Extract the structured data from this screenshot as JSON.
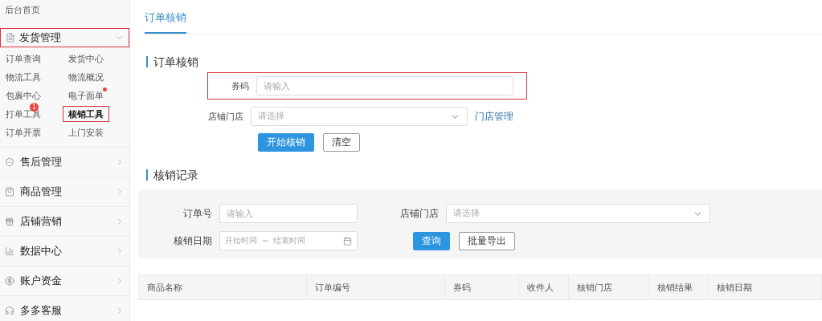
{
  "sidebar": {
    "home": "后台首页",
    "open_group": {
      "label": "发货管理",
      "kind": "doc",
      "expanded": true,
      "highlighted": true,
      "items": [
        {
          "label": "订单查询",
          "selected": false,
          "highlighted": false
        },
        {
          "label": "发货中心",
          "selected": false,
          "highlighted": false
        },
        {
          "label": "物流工具",
          "selected": false,
          "highlighted": false
        },
        {
          "label": "物流概况",
          "selected": false,
          "highlighted": false
        },
        {
          "label": "包裹中心",
          "selected": false,
          "highlighted": false
        },
        {
          "label": "电子面单",
          "selected": false,
          "highlighted": false,
          "dot": true
        },
        {
          "label": "打单工具",
          "selected": false,
          "highlighted": false,
          "badge": "1"
        },
        {
          "label": "核销工具",
          "selected": true,
          "highlighted": true
        },
        {
          "label": "订单开票",
          "selected": false,
          "highlighted": false
        },
        {
          "label": "上门安装",
          "selected": false,
          "highlighted": false
        }
      ]
    },
    "groups": [
      {
        "label": "售后管理",
        "kind": "shield",
        "expanded": false
      },
      {
        "label": "商品管理",
        "kind": "bag",
        "expanded": false
      },
      {
        "label": "店铺营销",
        "kind": "gift",
        "expanded": false
      },
      {
        "label": "数据中心",
        "kind": "chart",
        "expanded": false
      },
      {
        "label": "账户资金",
        "kind": "yen",
        "expanded": false
      },
      {
        "label": "多多客服",
        "kind": "headset",
        "expanded": false
      }
    ]
  },
  "tabs": [
    {
      "label": "订单核销",
      "selected": true
    }
  ],
  "verify": {
    "title": "订单核销",
    "fields": [
      {
        "kind": "input",
        "label": "券码",
        "placeholder": "请输入",
        "highlighted": true
      },
      {
        "kind": "select",
        "label": "店铺门店",
        "placeholder": "请选择",
        "link": "门店管理",
        "highlighted": false
      }
    ],
    "buttons": [
      {
        "label": "开始核销",
        "primary": true
      },
      {
        "label": "清空",
        "primary": false
      }
    ]
  },
  "records": {
    "title": "核销记录",
    "filters": {
      "order_no": {
        "label": "订单号",
        "placeholder": "请输入"
      },
      "store": {
        "label": "店铺门店",
        "placeholder": "请选择"
      },
      "date": {
        "label": "核销日期",
        "start": "开始时间",
        "separator": "~",
        "end": "结束时间"
      },
      "buttons": [
        {
          "label": "查询",
          "primary": true
        },
        {
          "label": "批量导出",
          "primary": false
        }
      ]
    },
    "table": {
      "columns": [
        "商品名称",
        "订单编号",
        "券码",
        "收件人",
        "核销门店",
        "核销结果",
        "核销日期"
      ]
    }
  }
}
